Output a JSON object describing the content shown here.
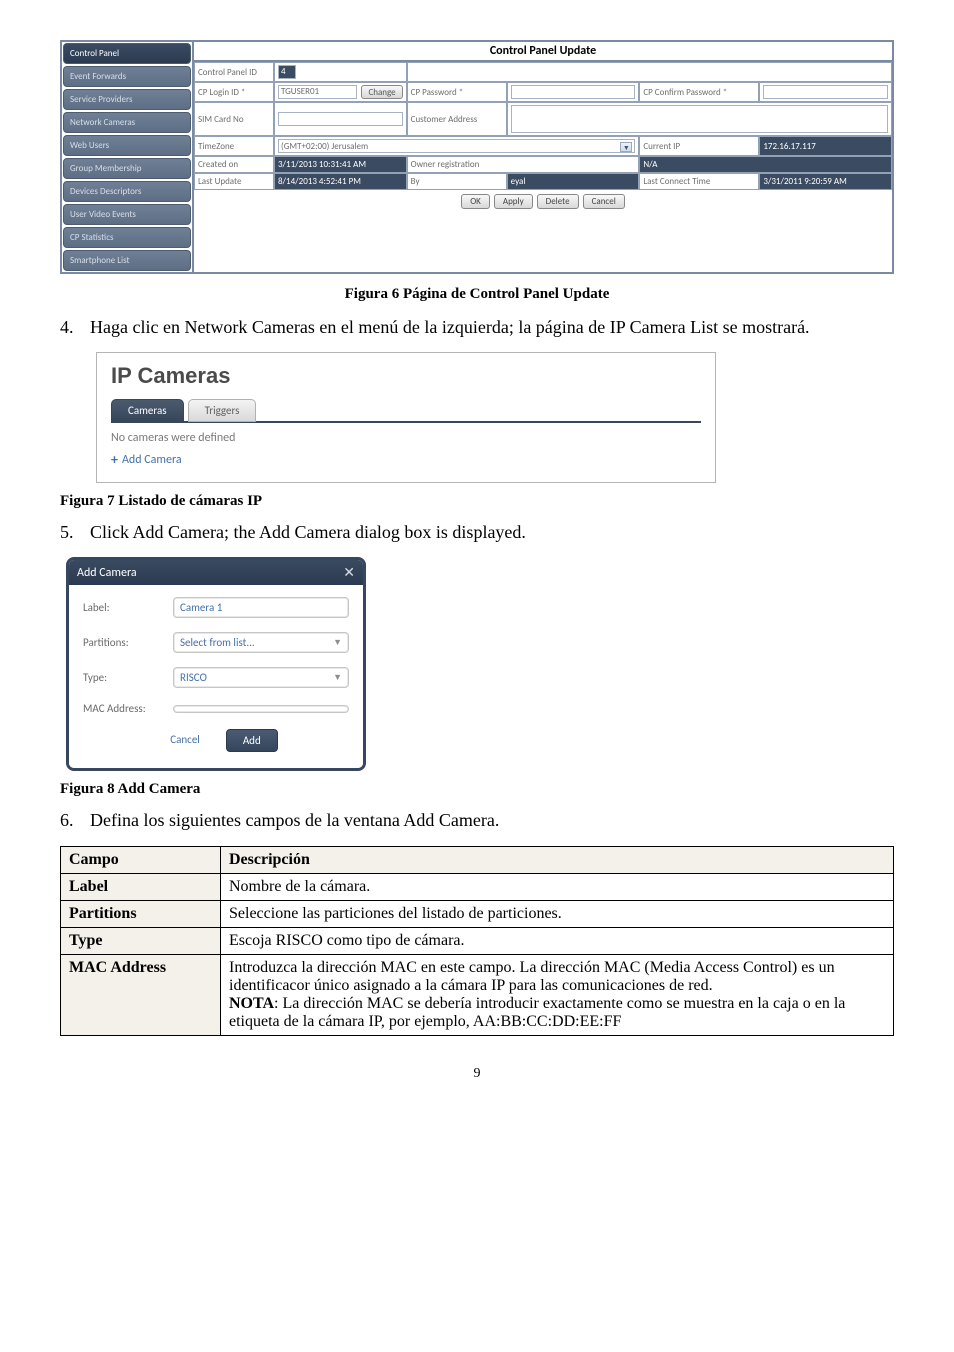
{
  "cpu": {
    "sidebar": [
      "Control Panel",
      "Event Forwards",
      "Service Providers",
      "Network Cameras",
      "Web Users",
      "Group Membership",
      "Devices Descriptors",
      "User Video Events",
      "CP Statistics",
      "Smartphone List"
    ],
    "title": "Control Panel Update",
    "labels": {
      "cpid": "Control Panel ID",
      "login": "CP Login ID *",
      "pw": "CP Password *",
      "cpw": "CP Confirm Password *",
      "sim": "SIM Card No",
      "caddr": "Customer Address",
      "tz": "TimeZone",
      "cip": "Current IP",
      "created": "Created on",
      "oreg": "Owner registration",
      "lup": "Last Update",
      "by": "By",
      "lct": "Last Connect Time",
      "change": "Change"
    },
    "values": {
      "cpid": "4",
      "login": "TGUSER01",
      "tz": "(GMT+02:00) Jerusalem",
      "cip": "172.16.17.117",
      "created": "3/11/2013 10:31:41 AM",
      "oreg": "N/A",
      "lup": "8/14/2013 4:52:41 PM",
      "by": "eyal",
      "lct": "3/31/2011 9:20:59 AM"
    },
    "buttons": [
      "OK",
      "Apply",
      "Delete",
      "Cancel"
    ]
  },
  "fig6": "Figura 6 Página de Control Panel Update",
  "step4": {
    "num": "4.",
    "text": "Haga clic en Network Cameras en el menú de la izquierda; la página de IP Camera List se mostrará."
  },
  "ipc": {
    "title": "IP Cameras",
    "tabs": {
      "cameras": "Cameras",
      "triggers": "Triggers"
    },
    "empty": "No cameras were defined",
    "add": "Add Camera"
  },
  "fig7": "Figura 7 Listado de cámaras IP",
  "step5": {
    "num": "5.",
    "text": "Click Add Camera; the Add Camera dialog box is displayed."
  },
  "addcam": {
    "title": "Add Camera",
    "label": {
      "lbl": "Label:",
      "val": "Camera 1"
    },
    "part": {
      "lbl": "Partitions:",
      "val": "Select from list..."
    },
    "type": {
      "lbl": "Type:",
      "val": "RISCO"
    },
    "mac": {
      "lbl": "MAC Address:"
    },
    "cancel": "Cancel",
    "add": "Add"
  },
  "fig8": "Figura 8 Add Camera",
  "step6": {
    "num": "6.",
    "text": "Defina los siguientes campos de la ventana Add Camera."
  },
  "table": {
    "heads": {
      "c": "Campo",
      "d": "Descripción"
    },
    "rows": {
      "label": {
        "c": "Label",
        "d": "Nombre de la cámara."
      },
      "part": {
        "c": "Partitions",
        "d": "Seleccione las particiones del listado de particiones."
      },
      "type": {
        "c": "Type",
        "d": "Escoja RISCO como tipo de cámara."
      },
      "mac": {
        "c": "MAC Address",
        "d1": "Introduzca la dirección MAC en este campo. La dirección MAC (Media Access Control) es un identificacor único asignado a la cámara IP para las comunicaciones de red.",
        "d2a": "NOTA",
        "d2b": ": La dirección MAC se debería introducir exactamente como se muestra en la caja o en la etiqueta de la cámara IP, por ejemplo, AA:BB:CC:DD:EE:FF"
      }
    }
  },
  "pagenum": "9"
}
